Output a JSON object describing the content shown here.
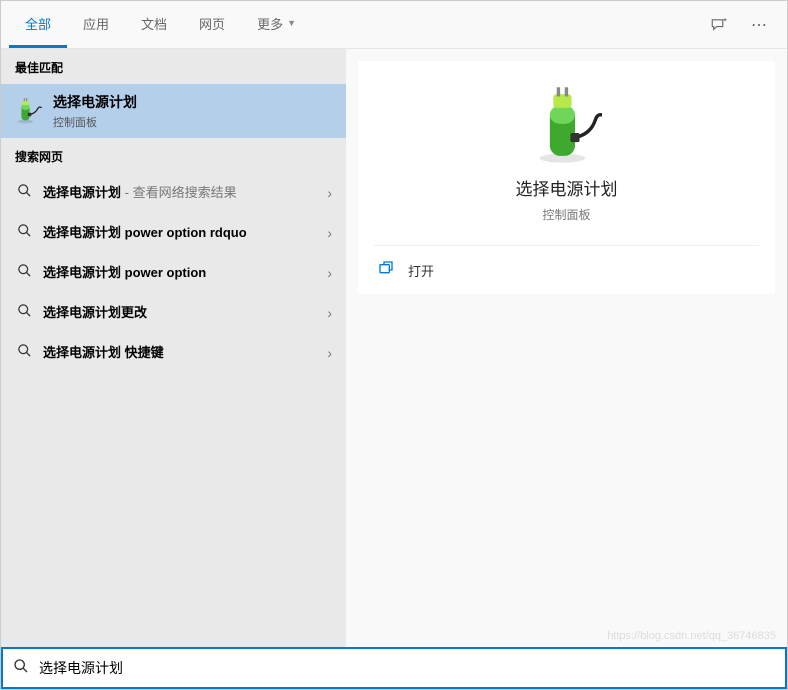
{
  "tabs": {
    "all": "全部",
    "apps": "应用",
    "docs": "文档",
    "web": "网页",
    "more": "更多"
  },
  "sections": {
    "best_match": "最佳匹配",
    "web_search": "搜索网页"
  },
  "best_match": {
    "title": "选择电源计划",
    "subtitle": "控制面板"
  },
  "web_results": [
    {
      "prefix": "选择电源计划",
      "suffix": " - 查看网络搜索结果",
      "suffix_bold": false
    },
    {
      "prefix": "选择电源计划",
      "suffix": " power option rdquo",
      "suffix_bold": true
    },
    {
      "prefix": "选择电源计划",
      "suffix": " power option",
      "suffix_bold": true
    },
    {
      "prefix": "选择电源计划",
      "suffix": "更改",
      "suffix_bold": true
    },
    {
      "prefix": "选择电源计划",
      "suffix": " 快捷键",
      "suffix_bold": true
    }
  ],
  "preview": {
    "title": "选择电源计划",
    "subtitle": "控制面板",
    "open": "打开"
  },
  "search": {
    "value": "选择电源计划"
  },
  "watermark": "https://blog.csdn.net/qq_36746835"
}
